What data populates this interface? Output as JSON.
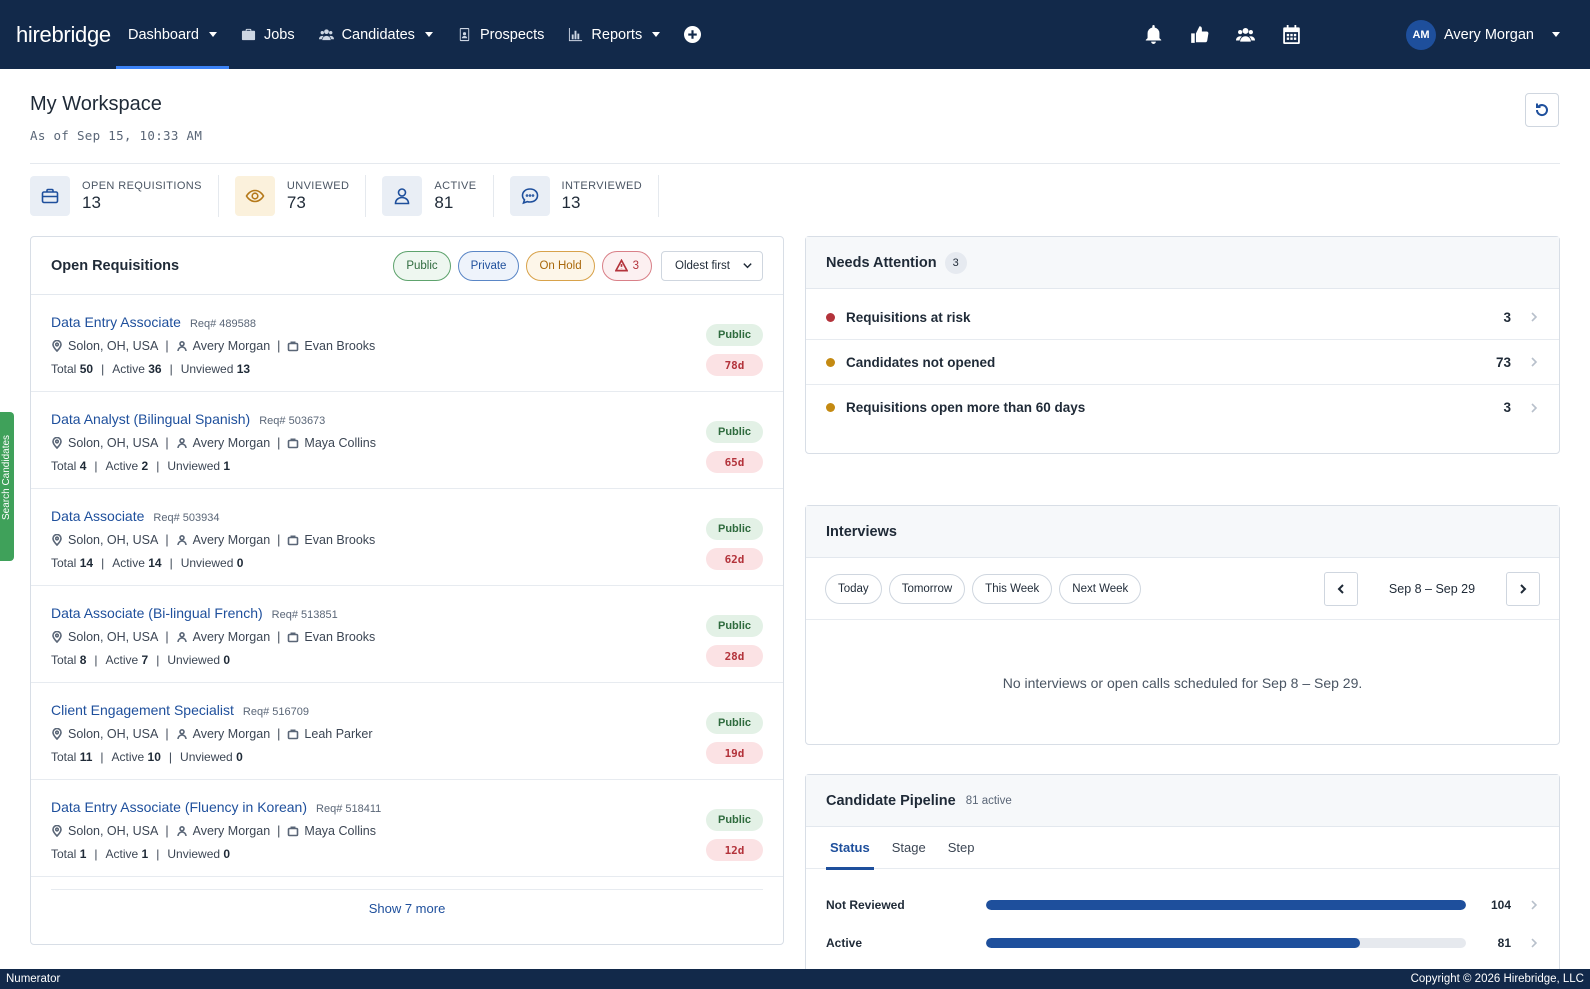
{
  "nav": {
    "logo": "hirebridge",
    "items": [
      {
        "label": "Dashboard",
        "icon": "none",
        "caret": true
      },
      {
        "label": "Jobs",
        "icon": "briefcase-icon",
        "caret": false
      },
      {
        "label": "Candidates",
        "icon": "users-icon",
        "caret": true
      },
      {
        "label": "Prospects",
        "icon": "id-badge-icon",
        "caret": false
      },
      {
        "label": "Reports",
        "icon": "bar-chart-icon",
        "caret": true
      }
    ],
    "add_icon": "plus-circle-icon",
    "right_icons": [
      "bell-icon",
      "thumbs-up-icon",
      "users-icon",
      "calendar-icon"
    ],
    "user_initials": "AM",
    "user_name": "Avery Morgan"
  },
  "workspace": {
    "title": "My Workspace",
    "subtitle": "As of Sep 15, 10:33 AM"
  },
  "stats": [
    {
      "label": "OPEN REQUISITIONS",
      "value": "13",
      "icon": "briefcase-icon",
      "bg": "#e9eef5",
      "stroke": "#1e4f9c"
    },
    {
      "label": "UNVIEWED",
      "value": "73",
      "icon": "eye-icon",
      "bg": "#fbf1dc",
      "stroke": "#b5791a"
    },
    {
      "label": "ACTIVE",
      "value": "81",
      "icon": "user-icon",
      "bg": "#e9eef5",
      "stroke": "#1e4f9c"
    },
    {
      "label": "INTERVIEWED",
      "value": "13",
      "icon": "chat-icon",
      "bg": "#e9eef5",
      "stroke": "#1e4f9c"
    }
  ],
  "requisitions": {
    "title": "Open Requisitions",
    "filters": {
      "public": "Public",
      "private": "Private",
      "on_hold": "On Hold",
      "alert_count": "3"
    },
    "sort": "Oldest first",
    "total_label": "Total",
    "active_label": "Active",
    "unviewed_label": "Unviewed",
    "rows": [
      {
        "title": "Data Entry Associate",
        "req": "Req# 489588",
        "location": "Solon, OH, USA",
        "recruiter": "Avery Morgan",
        "manager": "Evan Brooks",
        "total": "50",
        "active": "36",
        "unviewed": "13",
        "status": "Public",
        "age": "78d"
      },
      {
        "title": "Data Analyst (Bilingual Spanish)",
        "req": "Req# 503673",
        "location": "Solon, OH, USA",
        "recruiter": "Avery Morgan",
        "manager": "Maya Collins",
        "total": "4",
        "active": "2",
        "unviewed": "1",
        "status": "Public",
        "age": "65d"
      },
      {
        "title": "Data Associate",
        "req": "Req# 503934",
        "location": "Solon, OH, USA",
        "recruiter": "Avery Morgan",
        "manager": "Evan Brooks",
        "total": "14",
        "active": "14",
        "unviewed": "0",
        "status": "Public",
        "age": "62d"
      },
      {
        "title": "Data Associate (Bi-lingual French)",
        "req": "Req# 513851",
        "location": "Solon, OH, USA",
        "recruiter": "Avery Morgan",
        "manager": "Evan Brooks",
        "total": "8",
        "active": "7",
        "unviewed": "0",
        "status": "Public",
        "age": "28d"
      },
      {
        "title": "Client Engagement Specialist",
        "req": "Req# 516709",
        "location": "Solon, OH, USA",
        "recruiter": "Avery Morgan",
        "manager": "Leah Parker",
        "total": "11",
        "active": "10",
        "unviewed": "0",
        "status": "Public",
        "age": "19d"
      },
      {
        "title": "Data Entry Associate (Fluency in Korean)",
        "req": "Req# 518411",
        "location": "Solon, OH, USA",
        "recruiter": "Avery Morgan",
        "manager": "Maya Collins",
        "total": "1",
        "active": "1",
        "unviewed": "0",
        "status": "Public",
        "age": "12d"
      }
    ],
    "show_more": "Show 7 more"
  },
  "needs_attention": {
    "title": "Needs Attention",
    "count": "3",
    "rows": [
      {
        "label": "Requisitions at risk",
        "count": "3",
        "color": "#b3333b"
      },
      {
        "label": "Candidates not opened",
        "count": "73",
        "color": "#c48a12"
      },
      {
        "label": "Requisitions open more than 60 days",
        "count": "3",
        "color": "#c48a12"
      }
    ]
  },
  "interviews": {
    "title": "Interviews",
    "ranges": [
      "Today",
      "Tomorrow",
      "This Week",
      "Next Week"
    ],
    "range_label": "Sep 8 – Sep 29",
    "empty": "No interviews or open calls scheduled for Sep 8 – Sep 29."
  },
  "pipeline": {
    "title": "Candidate Pipeline",
    "subtitle": "81 active",
    "tabs": [
      "Status",
      "Stage",
      "Step"
    ],
    "max": 104,
    "rows": [
      {
        "label": "Not Reviewed",
        "value": 104
      },
      {
        "label": "Active",
        "value": 81
      }
    ]
  },
  "side_tab": "Search Candidates",
  "footer": {
    "left": "Numerator",
    "right": "Copyright © 2026 Hirebridge, LLC"
  }
}
